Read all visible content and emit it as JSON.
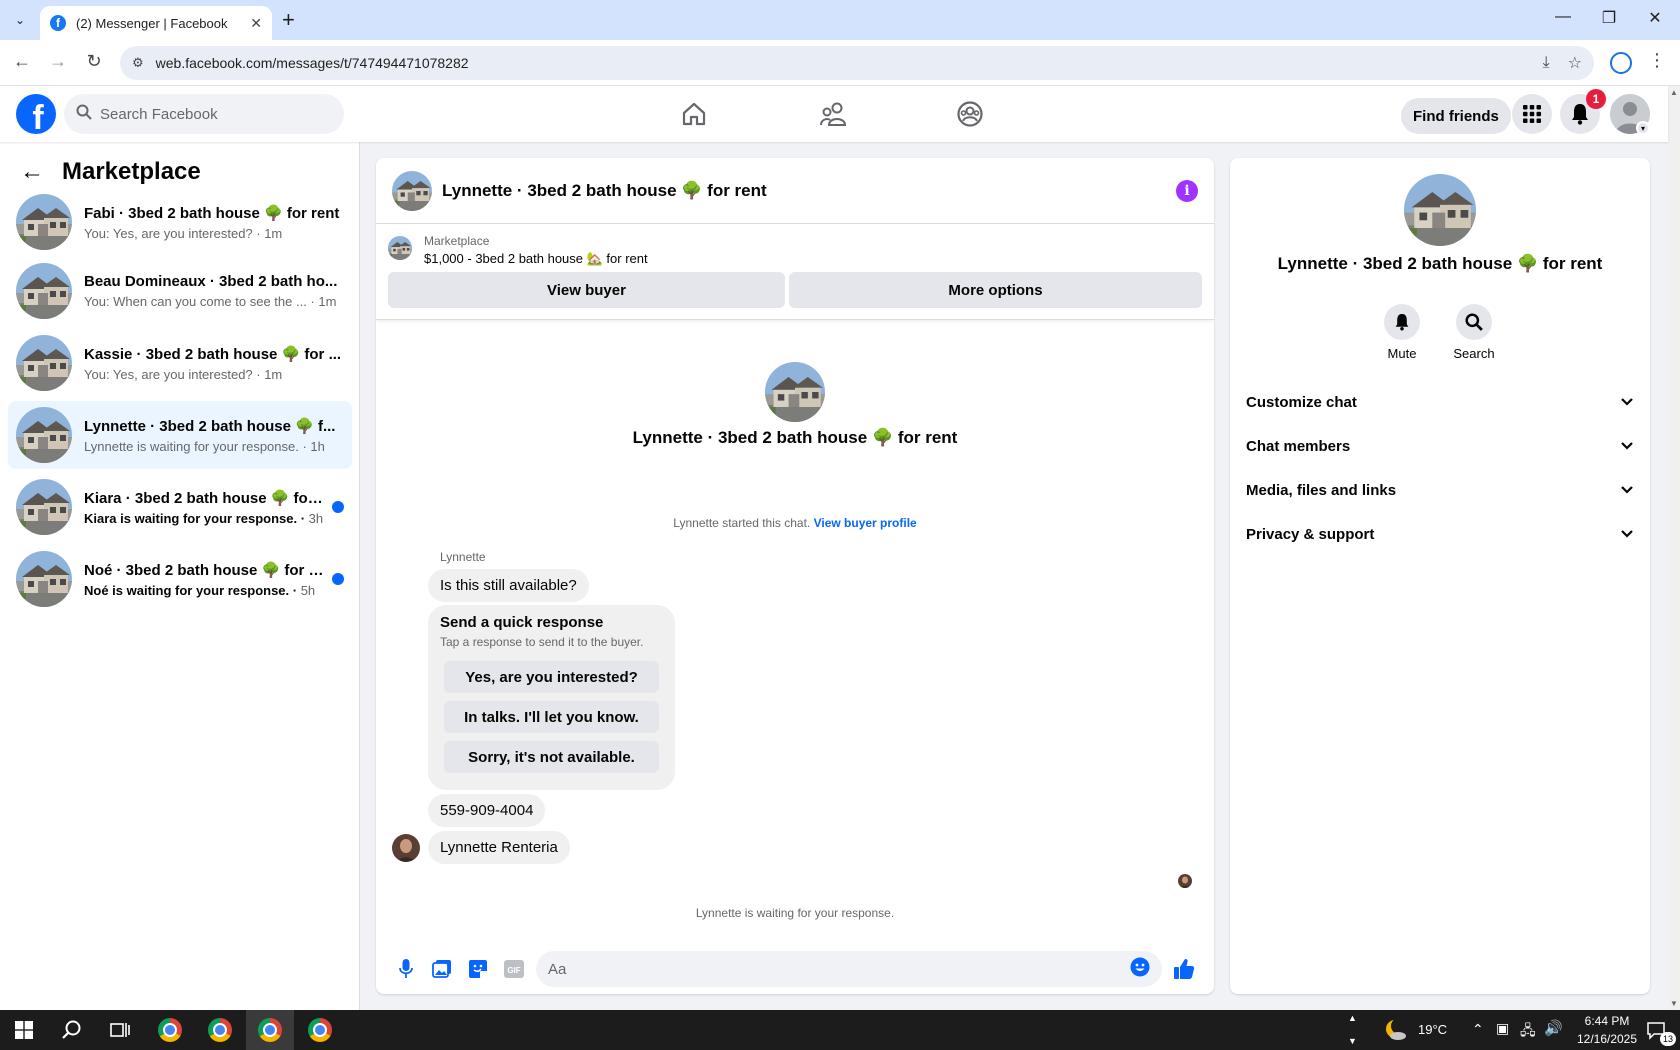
{
  "browser": {
    "tab_title": "(2) Messenger | Facebook",
    "url": "web.facebook.com/messages/t/747494471078282"
  },
  "fb": {
    "search_placeholder": "Search Facebook",
    "find_friends": "Find friends",
    "notification_count": "1"
  },
  "sidebar": {
    "title": "Marketplace",
    "conversations": [
      {
        "name": "Fabi · 3bed 2 bath house 🌳 for rent",
        "preview": "You: Yes, are you interested? ·",
        "time": " 1m",
        "unread": false
      },
      {
        "name": "Beau Domineaux · 3bed 2 bath ho...",
        "preview": "You: When can you come to see the ... ·",
        "time": " 1m",
        "unread": false
      },
      {
        "name": "Kassie · 3bed 2 bath house 🌳 for ...",
        "preview": "You: Yes, are you interested? ·",
        "time": " 1m",
        "unread": false
      },
      {
        "name": "Lynnette · 3bed 2 bath house 🌳 f...",
        "preview": "Lynnette is waiting for your response. ·",
        "time": " 1h",
        "unread": false
      },
      {
        "name": "Kiara · 3bed 2 bath house 🌳 for ...",
        "preview": "Kiara is waiting for your response. ·",
        "time": " 3h",
        "unread": true
      },
      {
        "name": "Noé · 3bed 2 bath house 🌳 for r...",
        "preview": "Noé is waiting for your response. ·",
        "time": " 5h",
        "unread": true
      }
    ]
  },
  "chat": {
    "title": "Lynnette · 3bed 2 bath house 🌳 for rent",
    "banner_label": "Marketplace",
    "banner_listing": "$1,000 - 3bed 2 bath house 🏡 for rent",
    "view_buyer": "View buyer",
    "more_options": "More options",
    "intro_name": "Lynnette · 3bed 2 bath house 🌳 for rent",
    "started_text": "Lynnette started this chat. ",
    "view_buyer_profile": "View buyer profile",
    "sender": "Lynnette",
    "messages": [
      "Is this still available?",
      "559-909-4004",
      "Lynnette Renteria"
    ],
    "quick_title": "Send a quick response",
    "quick_sub": "Tap a response to send it to the buyer.",
    "quick_replies": [
      "Yes, are you interested?",
      "In talks. I'll let you know.",
      "Sorry, it's not available."
    ],
    "waiting": "Lynnette is waiting for your response.",
    "composer_placeholder": "Aa"
  },
  "details": {
    "name": "Lynnette · 3bed 2 bath house 🌳 for rent",
    "mute": "Mute",
    "search": "Search",
    "sections": [
      "Customize chat",
      "Chat members",
      "Media, files and links",
      "Privacy & support"
    ]
  },
  "taskbar": {
    "temperature": "19°C",
    "time": "6:44 PM",
    "date": "12/16/2025",
    "notif_count": "13"
  },
  "colors": {
    "fb_blue": "#0866ff",
    "active_conv": "#ebf5ff",
    "info_purple": "#a033ff"
  }
}
